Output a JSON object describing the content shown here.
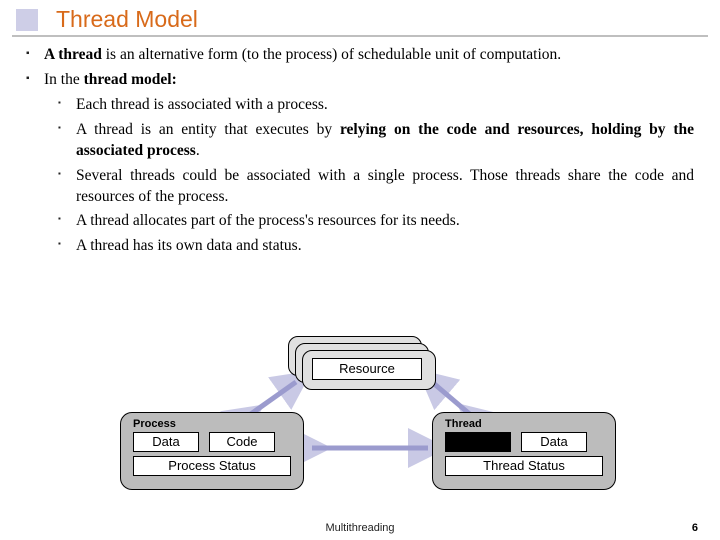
{
  "title": "Thread Model",
  "bullets": {
    "b1_pre": "A thread",
    "b1_post": " is an alternative form (to the process) of schedulable unit of computation.",
    "b2_pre": "In the ",
    "b2_bold": "thread model:",
    "sub1": "Each thread is associated with a process.",
    "sub2_pre": "A thread is an entity that executes by ",
    "sub2_bold": "relying on the code and resources, holding by the associated process",
    "sub2_post": ".",
    "sub3": "Several threads could be associated with a single process. Those threads share the code and resources of the process.",
    "sub4": "A thread allocates part of the process's resources for its needs.",
    "sub5": "A thread has its own data and status."
  },
  "diagram": {
    "resource": "Resource",
    "process_title": "Process",
    "thread_title": "Thread",
    "data": "Data",
    "code": "Code",
    "process_status": "Process Status",
    "thread_status": "Thread Status"
  },
  "footer": "Multithreading",
  "page": "6"
}
